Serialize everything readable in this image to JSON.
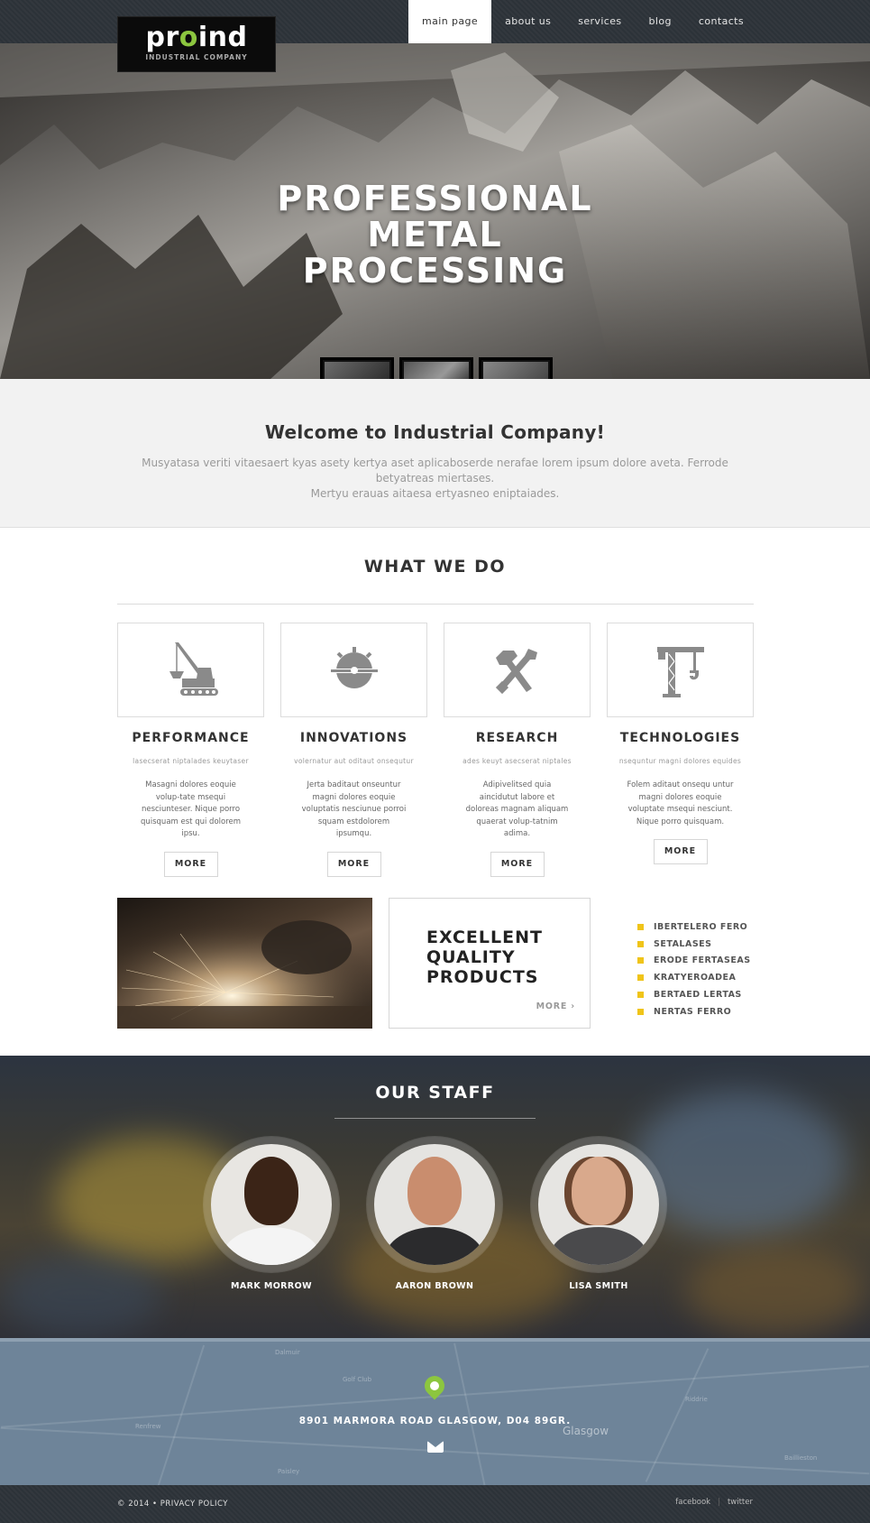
{
  "brand": {
    "name_pre": "pr",
    "name_o": "o",
    "name_post": "ind",
    "tagline": "INDUSTRIAL COMPANY",
    "accent": "#8cc63f"
  },
  "nav": [
    {
      "label": "main page",
      "active": true
    },
    {
      "label": "about us"
    },
    {
      "label": "services"
    },
    {
      "label": "blog"
    },
    {
      "label": "contacts"
    }
  ],
  "hero": {
    "line1": "PROFESSIONAL",
    "line2": "METAL",
    "line3": "PROCESSING"
  },
  "welcome": {
    "title": "Welcome to Industrial Company!",
    "text1": "Musyatasa veriti vitaesaert kyas asety kertya aset aplicaboserde nerafae lorem ipsum dolore aveta. Ferrode betyatreas miertases.",
    "text2": "Mertyu erauas aitaesa ertyasneo eniptaiades."
  },
  "what_we_do": {
    "title": "WHAT WE DO",
    "cards": [
      {
        "icon": "excavator-icon",
        "title": "PERFORMANCE",
        "sub": "lasecserat niptalades keuytaser",
        "desc": "Masagni dolores eoquie volup-tate msequi nesciunteser. Nique porro quisquam est qui dolorem ipsu.",
        "more": "MORE"
      },
      {
        "icon": "saw-blade-icon",
        "title": "INNOVATIONS",
        "sub": "volernatur aut oditaut onsequtur",
        "desc": "Jerta baditaut onseuntur magni dolores eoquie voluptatis nesciunue porroi squam estdolorem ipsumqu.",
        "more": "MORE"
      },
      {
        "icon": "tools-icon",
        "title": "RESEARCH",
        "sub": "ades keuyt asecserat niptales",
        "desc": "Adipivelitsed quia aincidutut labore et doloreas magnam aliquam quaerat volup-tatnim adima.",
        "more": "MORE"
      },
      {
        "icon": "crane-icon",
        "title": "TECHNOLOGIES",
        "sub": "nsequntur magni dolores equides",
        "desc": "Folem aditaut onsequ untur magni dolores eoquie voluptate msequi nesciunt. Nique porro quisquam.",
        "more": "MORE"
      }
    ]
  },
  "feature": {
    "title_l1": "EXCELLENT",
    "title_l2": "QUALITY",
    "title_l3": "PRODUCTS",
    "more": "MORE",
    "list": [
      "IBERTELERO FERO",
      "SETALASES",
      "ERODE FERTASEAS",
      "KRATYEROADEA",
      "BERTAED LERTAS",
      "NERTAS FERRO"
    ],
    "bullet_color": "#f0c419"
  },
  "staff": {
    "title": "OUR STAFF",
    "people": [
      {
        "name": "MARK MORROW"
      },
      {
        "name": "AARON BROWN"
      },
      {
        "name": "LISA SMITH"
      }
    ]
  },
  "map": {
    "address": "8901 MARMORA ROAD GLASGOW, D04 89GR.",
    "city": "Glasgow"
  },
  "footer": {
    "copyright": "© 2014 • PRIVACY POLICY",
    "social": [
      "facebook",
      "twitter"
    ]
  }
}
